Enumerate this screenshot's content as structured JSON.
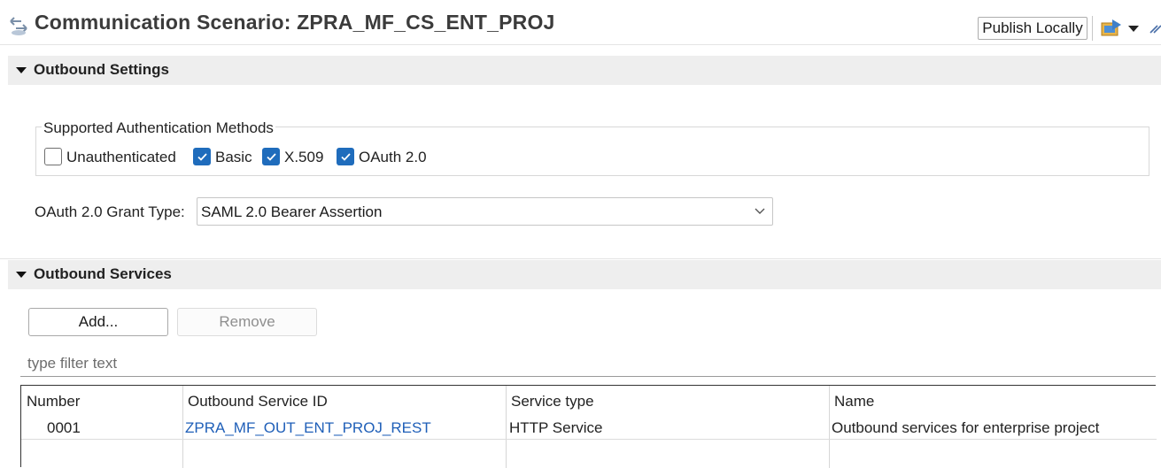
{
  "header": {
    "title": "Communication Scenario: ZPRA_MF_CS_ENT_PROJ",
    "publish_label": "Publish Locally"
  },
  "sections": {
    "outbound_settings": {
      "title": "Outbound Settings"
    },
    "outbound_services": {
      "title": "Outbound Services"
    }
  },
  "auth": {
    "legend": "Supported Authentication Methods",
    "methods": [
      {
        "label": "Unauthenticated",
        "checked": false
      },
      {
        "label": "Basic",
        "checked": true
      },
      {
        "label": "X.509",
        "checked": true
      },
      {
        "label": "OAuth 2.0",
        "checked": true
      }
    ]
  },
  "grant": {
    "label": "OAuth 2.0 Grant Type:",
    "value": "SAML 2.0 Bearer Assertion"
  },
  "services": {
    "add_label": "Add...",
    "remove_label": "Remove",
    "filter_placeholder": "type filter text",
    "columns": [
      "Number",
      "Outbound Service ID",
      "Service type",
      "Name"
    ],
    "rows": [
      {
        "number": "0001",
        "id": "ZPRA_MF_OUT_ENT_PROJ_REST",
        "type": "HTTP Service",
        "name": "Outbound services for enterprise project"
      }
    ]
  },
  "colors": {
    "accent": "#1f6cbc",
    "link": "#1f5fb8",
    "section_bg": "#eeeeee"
  },
  "icons": [
    "scenario-icon",
    "deploy-icon",
    "dropdown-arrow-icon",
    "more-icon",
    "collapse-triangle-icon",
    "chevron-down-icon",
    "checkmark-icon"
  ]
}
